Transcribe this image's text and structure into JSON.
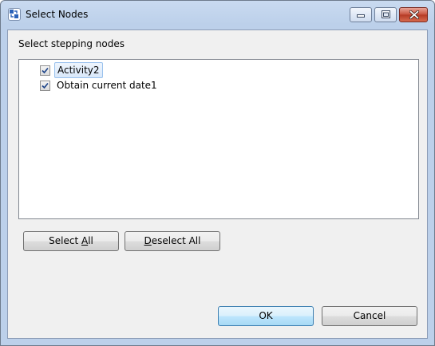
{
  "window": {
    "title": "Select Nodes"
  },
  "dialog": {
    "prompt": "Select stepping nodes",
    "nodes": [
      {
        "label": "Activity2",
        "checked": true,
        "selected": true
      },
      {
        "label": "Obtain current date1",
        "checked": true,
        "selected": false
      }
    ],
    "select_all": {
      "before": "Select ",
      "mnemonic": "A",
      "after": "ll"
    },
    "deselect_all": {
      "before": "",
      "mnemonic": "D",
      "after": "eselect All"
    },
    "ok_label": "OK",
    "cancel_label": "Cancel"
  },
  "colors": {
    "titlebar": "#c9daf0",
    "client": "#f0f0f0",
    "close_button": "#c7503b",
    "default_button_border": "#3c7fb1"
  },
  "icons": [
    "app-icon",
    "minimize-icon",
    "maximize-icon",
    "close-icon",
    "checkmark-icon"
  ]
}
